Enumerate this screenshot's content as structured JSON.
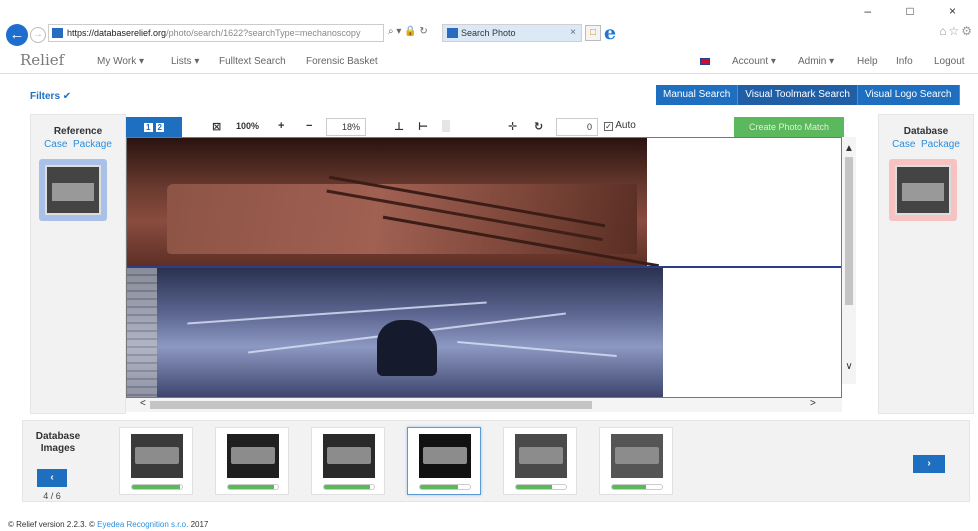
{
  "browser": {
    "url_host": "https://databaserelief.org",
    "url_path": "/photo/search/1622?searchType=mechanoscopy",
    "search_glyph": "⌕ ▾ 🔒 ↻",
    "tab_title": "Search Photo",
    "tab_close": "×",
    "new_tab": "□",
    "ie_icon": "e",
    "window_controls": "– □ ×",
    "favorites_icons": "⌂☆⚙"
  },
  "app": {
    "logo": "Relief",
    "nav": {
      "my_work": "My Work ▾",
      "lists": "Lists ▾",
      "fulltext": "Fulltext Search",
      "forensic": "Forensic Basket",
      "account": "Account ▾",
      "admin": "Admin ▾",
      "help": "Help",
      "info": "Info",
      "logout": "Logout"
    }
  },
  "filters": {
    "label": "Filters ✔"
  },
  "search_tabs": [
    "Manual Search",
    "Visual Toolmark Search",
    "Visual Logo Search"
  ],
  "reference": {
    "title": "Reference",
    "case": "Case",
    "package": "Package"
  },
  "database": {
    "title": "Database",
    "case": "Case",
    "package": "Package"
  },
  "toolbar": {
    "page1": "1",
    "page2": "2",
    "fit_icon": "⊠",
    "zoom_100": "100%",
    "zoom_in": "+",
    "zoom_out": "−",
    "zoom_value": "18%",
    "align_bottom": "⊥",
    "align_left": "⊢",
    "grid_icon": "▒",
    "move_icon": "✛",
    "rotate_icon": "↻",
    "rotation_value": "0",
    "auto_checked": "✓",
    "auto_label": "Auto",
    "create_match": "Create Photo Match"
  },
  "scroll": {
    "up": "▲",
    "down": "∨",
    "left": "<",
    "right": ">"
  },
  "strip": {
    "label": "Database Images",
    "prev": "‹",
    "next": "›",
    "counter": "4 / 6",
    "thumbnails": [
      {
        "match": 0.95
      },
      {
        "match": 0.92
      },
      {
        "match": 0.92
      },
      {
        "match": 0.75
      },
      {
        "match": 0.72
      },
      {
        "match": 0.68
      }
    ]
  },
  "footer": {
    "version": "© Relief version 2.2.3. ©",
    "company": "Eyedea Recognition s.r.o.",
    "year": "2017"
  }
}
